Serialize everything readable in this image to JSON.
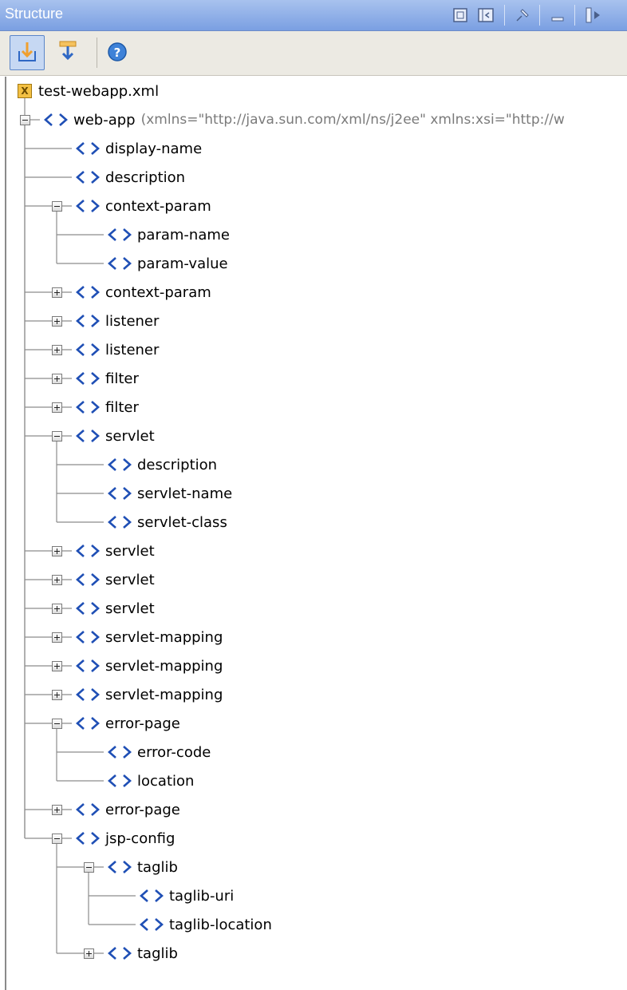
{
  "window": {
    "title": "Structure"
  },
  "toolbar": {
    "buttons": [
      {
        "name": "autoscroll-to-source",
        "active": true
      },
      {
        "name": "autoscroll-from-source",
        "active": false
      },
      {
        "name": "help",
        "active": false
      }
    ]
  },
  "tree": {
    "root": {
      "label": "test-webapp.xml",
      "icon": "xml-file-icon"
    },
    "nodes": [
      {
        "label": "web-app",
        "attrs": "(xmlns=\"http://java.sun.com/xml/ns/j2ee\" xmlns:xsi=\"http://w",
        "depth": 0,
        "state": "expanded"
      },
      {
        "label": "display-name",
        "depth": 1,
        "state": "leaf"
      },
      {
        "label": "description",
        "depth": 1,
        "state": "leaf"
      },
      {
        "label": "context-param",
        "depth": 1,
        "state": "expanded"
      },
      {
        "label": "param-name",
        "depth": 2,
        "state": "leaf"
      },
      {
        "label": "param-value",
        "depth": 2,
        "state": "leaf"
      },
      {
        "label": "context-param",
        "depth": 1,
        "state": "collapsed"
      },
      {
        "label": "listener",
        "depth": 1,
        "state": "collapsed"
      },
      {
        "label": "listener",
        "depth": 1,
        "state": "collapsed"
      },
      {
        "label": "filter",
        "depth": 1,
        "state": "collapsed"
      },
      {
        "label": "filter",
        "depth": 1,
        "state": "collapsed"
      },
      {
        "label": "servlet",
        "depth": 1,
        "state": "expanded"
      },
      {
        "label": "description",
        "depth": 2,
        "state": "leaf"
      },
      {
        "label": "servlet-name",
        "depth": 2,
        "state": "leaf"
      },
      {
        "label": "servlet-class",
        "depth": 2,
        "state": "leaf"
      },
      {
        "label": "servlet",
        "depth": 1,
        "state": "collapsed"
      },
      {
        "label": "servlet",
        "depth": 1,
        "state": "collapsed"
      },
      {
        "label": "servlet",
        "depth": 1,
        "state": "collapsed"
      },
      {
        "label": "servlet-mapping",
        "depth": 1,
        "state": "collapsed"
      },
      {
        "label": "servlet-mapping",
        "depth": 1,
        "state": "collapsed"
      },
      {
        "label": "servlet-mapping",
        "depth": 1,
        "state": "collapsed"
      },
      {
        "label": "error-page",
        "depth": 1,
        "state": "expanded"
      },
      {
        "label": "error-code",
        "depth": 2,
        "state": "leaf"
      },
      {
        "label": "location",
        "depth": 2,
        "state": "leaf"
      },
      {
        "label": "error-page",
        "depth": 1,
        "state": "collapsed"
      },
      {
        "label": "jsp-config",
        "depth": 1,
        "state": "expanded"
      },
      {
        "label": "taglib",
        "depth": 2,
        "state": "expanded"
      },
      {
        "label": "taglib-uri",
        "depth": 3,
        "state": "leaf"
      },
      {
        "label": "taglib-location",
        "depth": 3,
        "state": "leaf"
      },
      {
        "label": "taglib",
        "depth": 2,
        "state": "collapsed"
      }
    ]
  },
  "colors": {
    "tag_icon": "#1f4fb5",
    "title_bar": "#7a9fe2",
    "tree_lines": "#8c8c8c",
    "attr_text": "#7a7a7a"
  }
}
